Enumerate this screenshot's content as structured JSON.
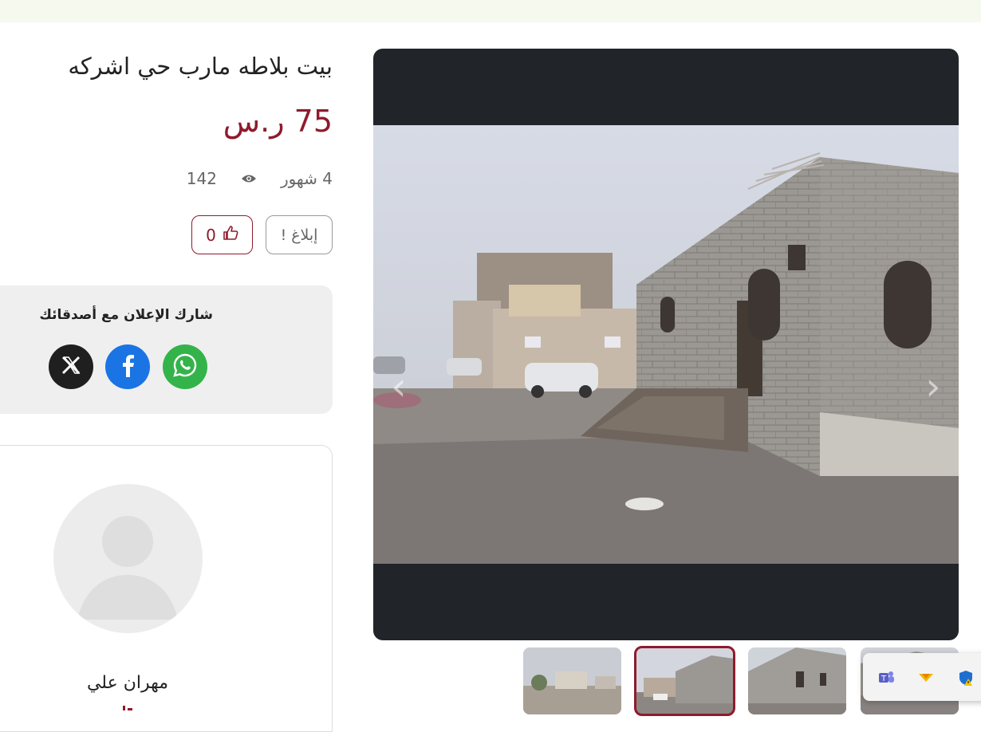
{
  "listing": {
    "title": "بيت بلاطه مارب حي اشركه",
    "price": "75 ر.س",
    "age": "4 شهور",
    "views": "142"
  },
  "actions": {
    "report_label": "إبلاغ",
    "report_icon": "!",
    "like_count": "0"
  },
  "share": {
    "title": "شارك الإعلان مع أصدقائك",
    "networks": [
      "x",
      "facebook",
      "whatsapp"
    ]
  },
  "seller": {
    "name": "مهران علي"
  },
  "gallery": {
    "prev_icon": "‹",
    "next_icon": "›",
    "thumbnail_count": 4,
    "active_thumbnail": 2
  },
  "tray_icons": [
    "teams-icon",
    "notification-icon",
    "defender-warning-icon"
  ],
  "colors": {
    "accent": "#8e1b2e",
    "gallery_bg": "#212428",
    "facebook": "#1b74e4",
    "whatsapp": "#34b34a",
    "x": "#1f1f1f"
  }
}
